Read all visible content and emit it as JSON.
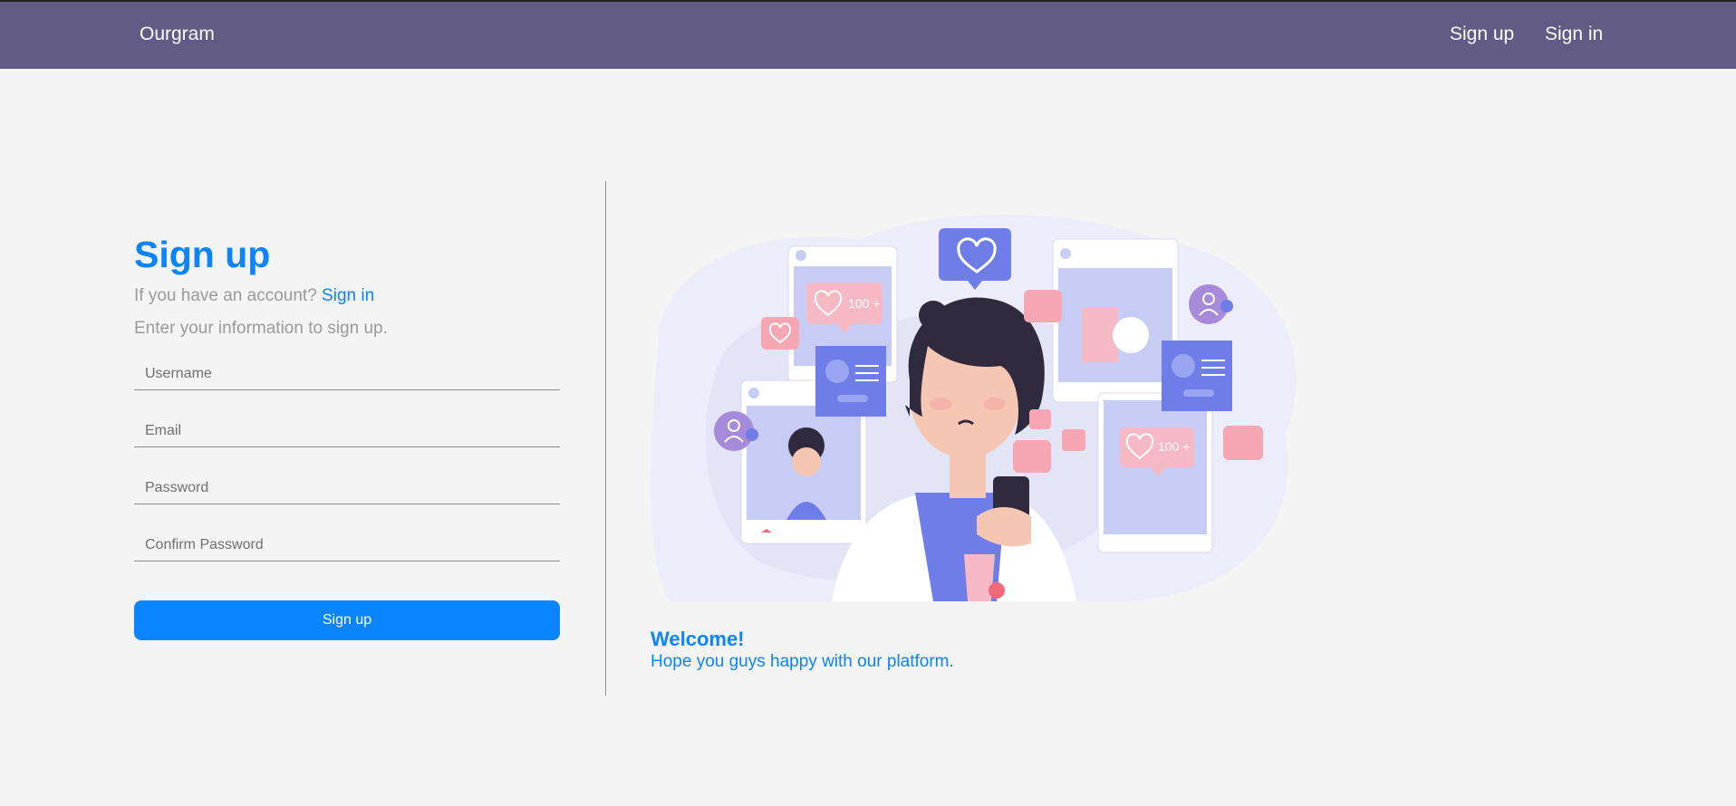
{
  "navbar": {
    "brand": "Ourgram",
    "signup": "Sign up",
    "signin": "Sign in"
  },
  "form": {
    "title": "Sign up",
    "have_account": "If you have an account?",
    "signin_link": "Sign in",
    "instruction": "Enter your information to sign up.",
    "username_placeholder": "Username",
    "email_placeholder": "Email",
    "password_placeholder": "Password",
    "confirm_placeholder": "Confirm Password",
    "submit_label": "Sign up"
  },
  "welcome": {
    "title": "Welcome!",
    "text": "Hope you guys happy with our platform."
  },
  "illustration": {
    "badge_left": "100 +",
    "badge_right": "100 +"
  },
  "colors": {
    "navbar": "#625b85",
    "accent": "#0a84ff",
    "background": "#f4f4f4"
  }
}
